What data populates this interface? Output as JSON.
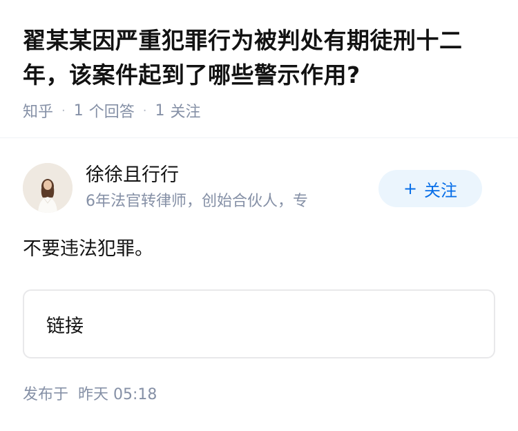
{
  "question": {
    "title": "翟某某因严重犯罪行为被判处有期徒刑十二年，该案件起到了哪些警示作用?",
    "source": "知乎",
    "answer_count": "1",
    "answer_label": "个回答",
    "follower_count": "1",
    "follower_label": "关注"
  },
  "author": {
    "name": "徐徐且行行",
    "bio": "6年法官转律师，创始合伙人，专",
    "follow_label": "关注",
    "follow_icon": "plus-icon"
  },
  "answer": {
    "content": "不要违法犯罪。",
    "link_label": "链接",
    "publish_prefix": "发布于",
    "publish_time": "昨天 05:18"
  },
  "colors": {
    "accent": "#056de8",
    "follow_bg": "#ebf5fd",
    "meta_text": "#8590a6",
    "title_text": "#121212"
  }
}
